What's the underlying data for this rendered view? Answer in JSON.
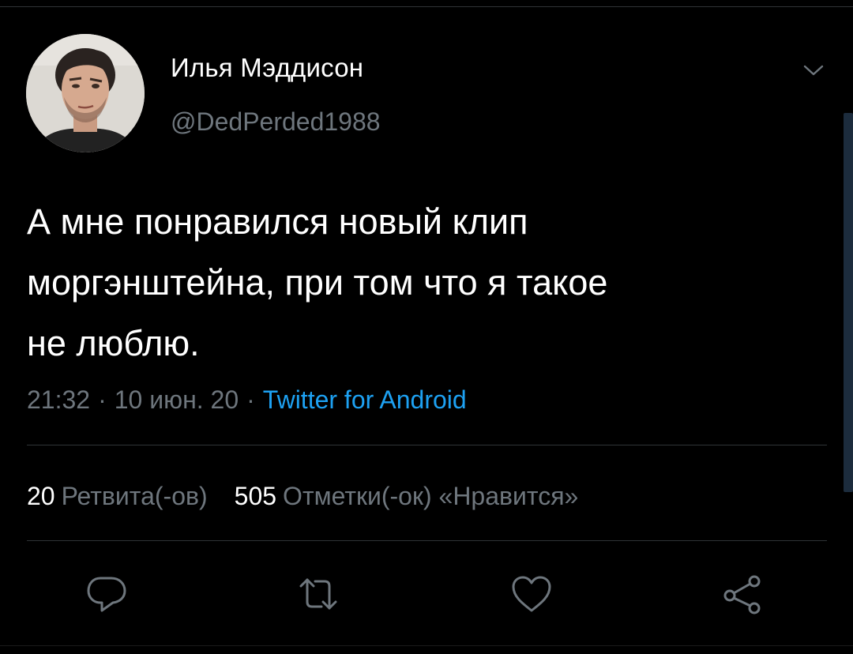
{
  "tweet": {
    "author": {
      "display_name": "Илья Мэддисон",
      "handle": "@DedPerded1988"
    },
    "text_lines": [
      "А мне понравился новый клип",
      "моргэнштейна, при том что я такое",
      "не люблю."
    ],
    "meta": {
      "time": "21:32",
      "date": "10 июн. 20",
      "separator": "·",
      "source": "Twitter for Android"
    },
    "stats": {
      "retweets_count": "20",
      "retweets_label": "Ретвита(-ов)",
      "likes_count": "505",
      "likes_label": "Отметки(-ок) «Нравится»"
    },
    "actions": [
      {
        "icon": "reply-icon"
      },
      {
        "icon": "retweet-icon"
      },
      {
        "icon": "like-icon"
      },
      {
        "icon": "share-icon"
      }
    ]
  },
  "colors": {
    "background": "#000000",
    "text_primary": "#ffffff",
    "text_secondary": "#6e767d",
    "accent": "#1da1f2",
    "divider": "#2f3336"
  }
}
